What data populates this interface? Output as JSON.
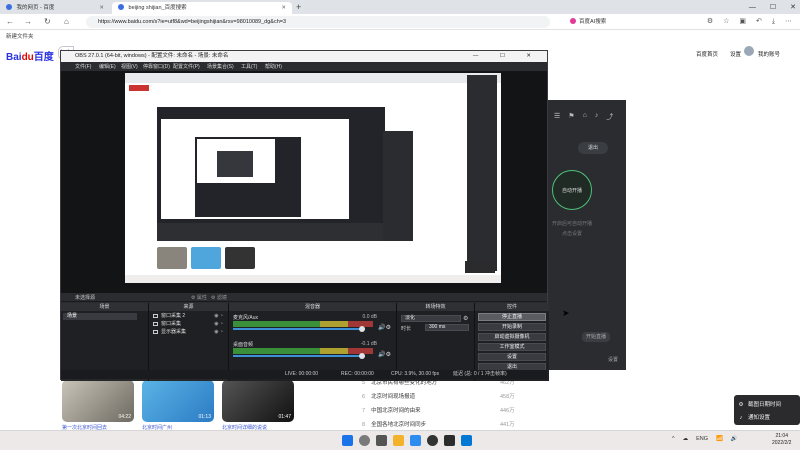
{
  "browser": {
    "tabs": [
      {
        "label": "我的网页 - 百度"
      },
      {
        "label": "beijing shijian_百度搜索"
      }
    ],
    "new_tab": "+",
    "url": "https://www.baidu.com/s?ie=utf8&wd=beijingshijian&rsv=98010089_dg&ch=3",
    "ai_search": "百度AI搜索",
    "bookmark": "新建文件夹",
    "win_controls": [
      "—",
      "☐",
      "✕"
    ],
    "nav": [
      "←",
      "→",
      "↻",
      "⌂"
    ]
  },
  "baidu": {
    "logo_left": "Bai",
    "logo_mid": "du",
    "logo_right": "百度",
    "search_value": "bei",
    "links": [
      "百度首页",
      "设置"
    ],
    "user": "我的账号",
    "left_fragments": [
      "Q",
      "百",
      "北",
      "北",
      "北",
      "北",
      "北",
      "bei"
    ],
    "videos": [
      {
        "caption": "第一次北京时间回去",
        "duration": "04:22"
      },
      {
        "caption": "北京时间广州",
        "duration": "01:13"
      },
      {
        "caption": "北京时间详细的说说",
        "duration": "01:47"
      }
    ],
    "hot": [
      {
        "num": "5",
        "text": "北京市民有哪些变化的地方",
        "count": "462万"
      },
      {
        "num": "6",
        "text": "北京时间现场报道",
        "count": "458万"
      },
      {
        "num": "7",
        "text": "中国北京时间的由来",
        "count": "446万"
      },
      {
        "num": "8",
        "text": "全国各地北京时间同步",
        "count": "441万"
      },
      {
        "num": "9",
        "text": "今日北京时间标准时间",
        "count": "435万"
      }
    ]
  },
  "side_panel": {
    "icons": [
      "☰",
      "⚑",
      "⌂",
      "♪",
      "⤴"
    ],
    "exit": "退出",
    "auto": "自动开播",
    "line1": "开启后可自动开播",
    "line2": "点击设置",
    "small": "开始直播",
    "bottom": "设置"
  },
  "obs": {
    "title": "OBS 27.0.1 (64-bit, windows) - 配置文件: 未命名 - 场景: 未命名",
    "title_controls": "— ☐ ✕",
    "menu": [
      "文件(F)",
      "编辑(E)",
      "视图(V)",
      "停靠窗口(D)",
      "配置文件(P)",
      "场景集合(S)",
      "工具(T)",
      "帮助(H)"
    ],
    "docks_label": "未选择源",
    "docks_props": "⚙ 属性",
    "docks_filter": "⚙ 滤镜",
    "scenes_header": "场景",
    "scene_item": "场景",
    "sources_header": "来源",
    "sources": [
      "窗口采集 2",
      "窗口采集",
      "显示器采集"
    ],
    "mixer_header": "混音器",
    "mixer": [
      {
        "name": "麦克风/Aux",
        "db": "0.0 dB"
      },
      {
        "name": "桌面音频",
        "db": "-0.1 dB"
      }
    ],
    "transitions_header": "转场特效",
    "transition_type": "淡化",
    "duration_label": "时长",
    "duration_value": "300 ms",
    "controls_header": "控件",
    "controls": [
      "停止直播",
      "开始录制",
      "启动虚拟摄像机",
      "工作室模式",
      "设置",
      "退出"
    ],
    "dock_buttons": "+ — ∧ ∨",
    "status": {
      "live": "LIVE: 00:00:00",
      "rec": "REC: 00:00:00",
      "cpu": "CPU: 3.9%, 30.00 fps",
      "delay": "延迟 (总: 0 / 1 冲击帧率)"
    }
  },
  "notification": [
    "截图日期时间",
    "通知设置"
  ],
  "taskbar": {
    "tray": [
      "^",
      "☁",
      "ENG",
      "📶",
      "🔊"
    ],
    "time": "21:04",
    "date": "2022/2/2"
  }
}
